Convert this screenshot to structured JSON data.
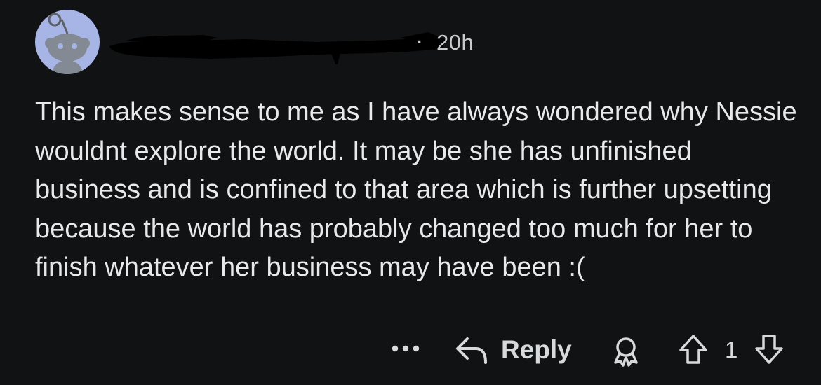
{
  "comment": {
    "author": "",
    "separator": "·",
    "timestamp": "20h",
    "body": "This makes sense to me as I have always wondered why Nessie wouldnt explore the world. It may be she has unfinished business and is confined to that area which is further upsetting because the world has probably changed too much for her to finish whatever her business may have been :("
  },
  "actions": {
    "more_icon": "more-horizontal-icon",
    "reply_icon": "reply-arrow-icon",
    "reply_label": "Reply",
    "award_icon": "award-icon",
    "upvote_icon": "upvote-arrow-icon",
    "vote_count": "1",
    "downvote_icon": "downvote-arrow-icon"
  },
  "colors": {
    "background": "#111213",
    "text": "#e8e9ea",
    "avatar": "#a7b4e6"
  }
}
